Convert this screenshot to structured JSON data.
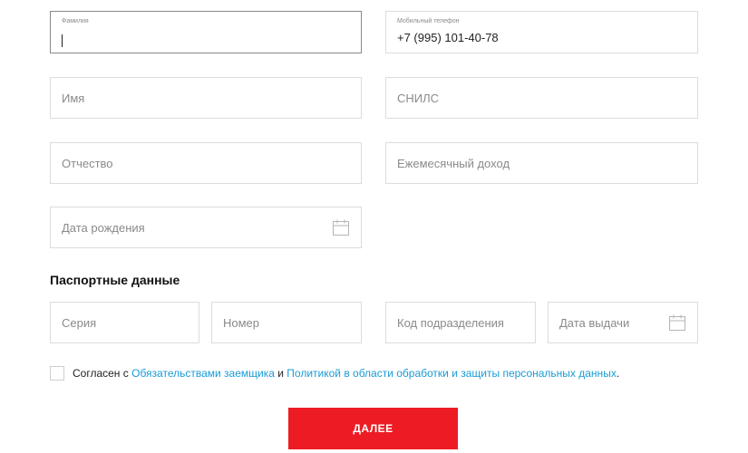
{
  "form": {
    "surname": {
      "label": "Фамилия",
      "value": ""
    },
    "mobile": {
      "label": "Мобильный телефон",
      "value": "+7 (995) 101-40-78"
    },
    "first_name": {
      "placeholder": "Имя"
    },
    "snils": {
      "placeholder": "СНИЛС"
    },
    "patronymic": {
      "placeholder": "Отчество"
    },
    "monthly_income": {
      "placeholder": "Ежемесячный доход"
    },
    "birth_date": {
      "placeholder": "Дата рождения",
      "icon": "calendar-icon"
    }
  },
  "passport": {
    "title": "Паспортные данные",
    "series": {
      "placeholder": "Серия"
    },
    "number": {
      "placeholder": "Номер"
    },
    "division_code": {
      "placeholder": "Код подразделения"
    },
    "issue_date": {
      "placeholder": "Дата выдачи",
      "icon": "calendar-icon"
    }
  },
  "consent": {
    "checked": false,
    "prefix": "Согласен с ",
    "link1": "Обязательствами заемщика",
    "middle": " и ",
    "link2": "Политикой в области обработки и защиты персональных данных",
    "suffix": "."
  },
  "submit": {
    "label": "ДАЛЕЕ"
  },
  "colors": {
    "accent": "#ed1c24",
    "link": "#1a9bd7",
    "border": "#dcdcdc"
  }
}
